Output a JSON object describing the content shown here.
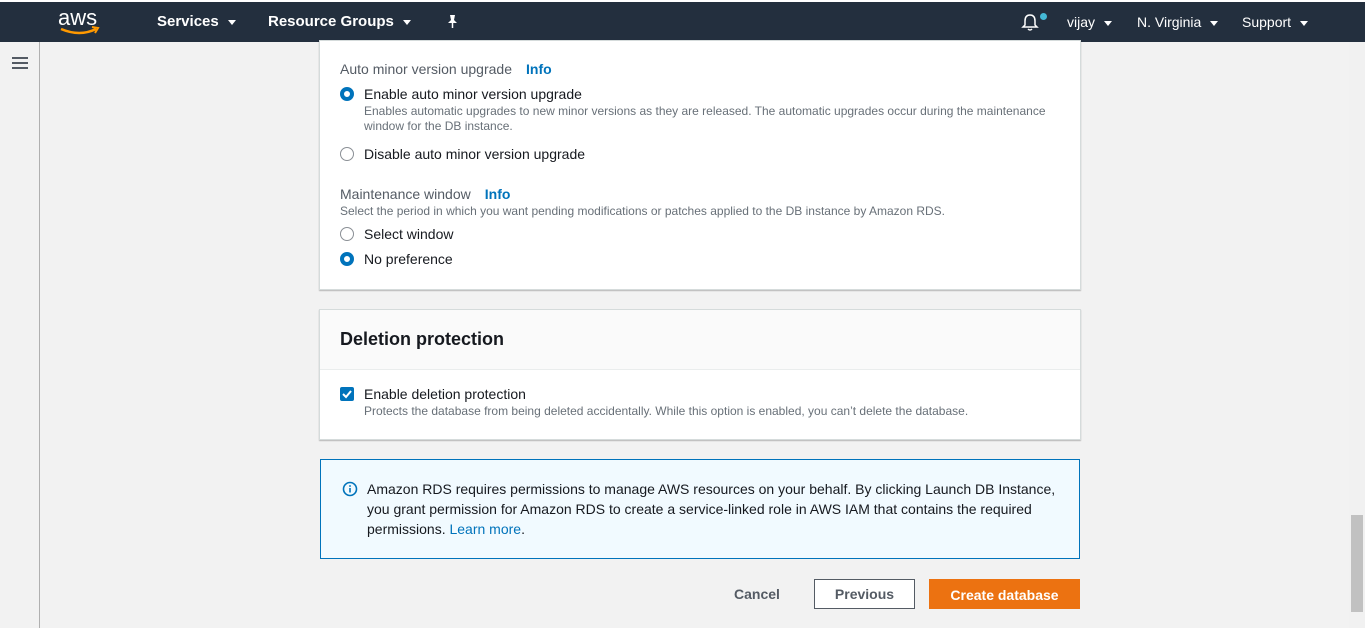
{
  "topbar": {
    "logo_text": "aws",
    "services": "Services",
    "resource_groups": "Resource Groups",
    "user": "vijay",
    "region": "N. Virginia",
    "support": "Support",
    "icons": {
      "pin": "pin-icon",
      "bell": "bell-icon"
    }
  },
  "maintenance": {
    "minor_label": "Auto minor version upgrade",
    "info": "Info",
    "enable_label": "Enable auto minor version upgrade",
    "enable_desc": "Enables automatic upgrades to new minor versions as they are released. The automatic upgrades occur during the maintenance window for the DB instance.",
    "disable_label": "Disable auto minor version upgrade",
    "minor_selected": "enable",
    "window_label": "Maintenance window",
    "window_desc": "Select the period in which you want pending modifications or patches applied to the DB instance by Amazon RDS.",
    "select_window": "Select window",
    "no_preference": "No preference",
    "window_selected": "no_preference"
  },
  "deletion": {
    "heading": "Deletion protection",
    "checkbox_label": "Enable deletion protection",
    "checkbox_desc": "Protects the database from being deleted accidentally. While this option is enabled, you can’t delete the database.",
    "checked": true
  },
  "alert": {
    "text": "Amazon RDS requires permissions to manage AWS resources on your behalf. By clicking Launch DB Instance, you grant permission for Amazon RDS to create a service-linked role in AWS IAM that contains the required permissions.",
    "link": "Learn more",
    "suffix": "."
  },
  "actions": {
    "cancel": "Cancel",
    "previous": "Previous",
    "create": "Create database"
  },
  "colors": {
    "topbar": "#232f3e",
    "accent": "#0073bb",
    "primary_button": "#ec7211"
  }
}
